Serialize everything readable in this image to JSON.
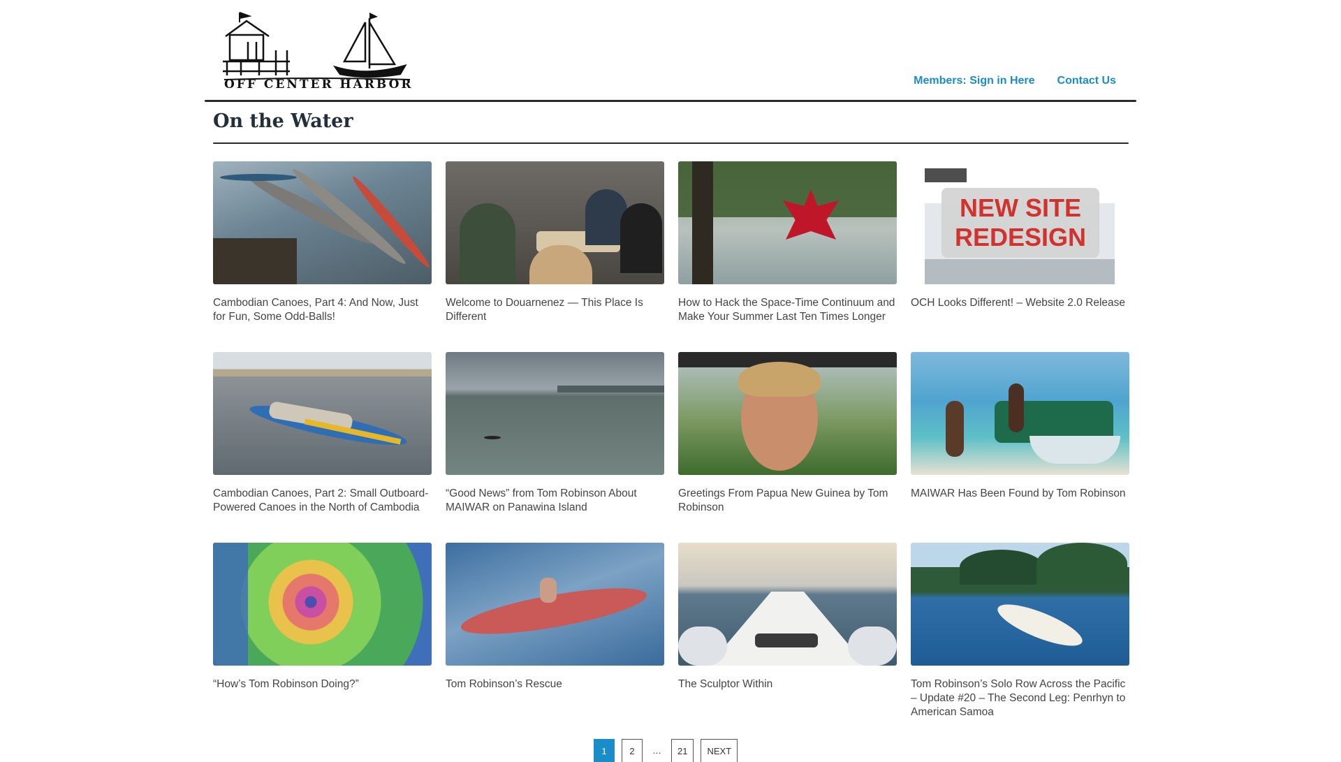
{
  "site": {
    "logo_text": "OFF CENTER HARBOR",
    "nav": {
      "sign_in": "Members: Sign in Here",
      "contact": "Contact Us"
    }
  },
  "page": {
    "title": "On the Water"
  },
  "posts": [
    {
      "title": "Cambodian Canoes, Part 4: And Now, Just for Fun, Some Odd-Balls!",
      "image": "long-canoes-on-river"
    },
    {
      "title": "Welcome to Douarnenez — This Place Is Different",
      "image": "people-at-dinner-table"
    },
    {
      "title": "How to Hack the Space-Time Continuum and Make Your Summer Last Ten Times Longer",
      "image": "red-maple-leaves-over-water"
    },
    {
      "title": "OCH Looks Different! – Website 2.0 Release",
      "image": "new-site-redesign-screenshot",
      "overlay": "NEW SITE REDESIGN"
    },
    {
      "title": "Cambodian Canoes, Part 2: Small Outboard-Powered Canoes in the North of Cambodia",
      "image": "painted-canoe-on-shore"
    },
    {
      "title": "“Good News” from Tom Robinson About MAIWAR on Panawina Island",
      "image": "kayak-on-grey-sea"
    },
    {
      "title": "Greetings From Papua New Guinea by Tom Robinson",
      "image": "smiling-man-selfie"
    },
    {
      "title": "MAIWAR Has Been Found by Tom Robinson",
      "image": "outrigger-boat-on-beach"
    },
    {
      "title": "“How’s Tom Robinson Doing?”",
      "image": "weather-map-cyclone"
    },
    {
      "title": "Tom Robinson’s Rescue",
      "image": "capsized-red-boat"
    },
    {
      "title": "The Sculptor Within",
      "image": "bow-of-rowing-boat"
    },
    {
      "title": "Tom Robinson’s Solo Row Across the Pacific – Update #20 – The Second Leg: Penrhyn to American Samoa",
      "image": "white-boat-in-harbor"
    }
  ],
  "pagination": {
    "current": "1",
    "next_page": "2",
    "ellipsis": "…",
    "last": "21",
    "next": "NEXT"
  },
  "colors": {
    "link": "#1a8cc8",
    "title": "#23303a",
    "text": "#444444"
  }
}
